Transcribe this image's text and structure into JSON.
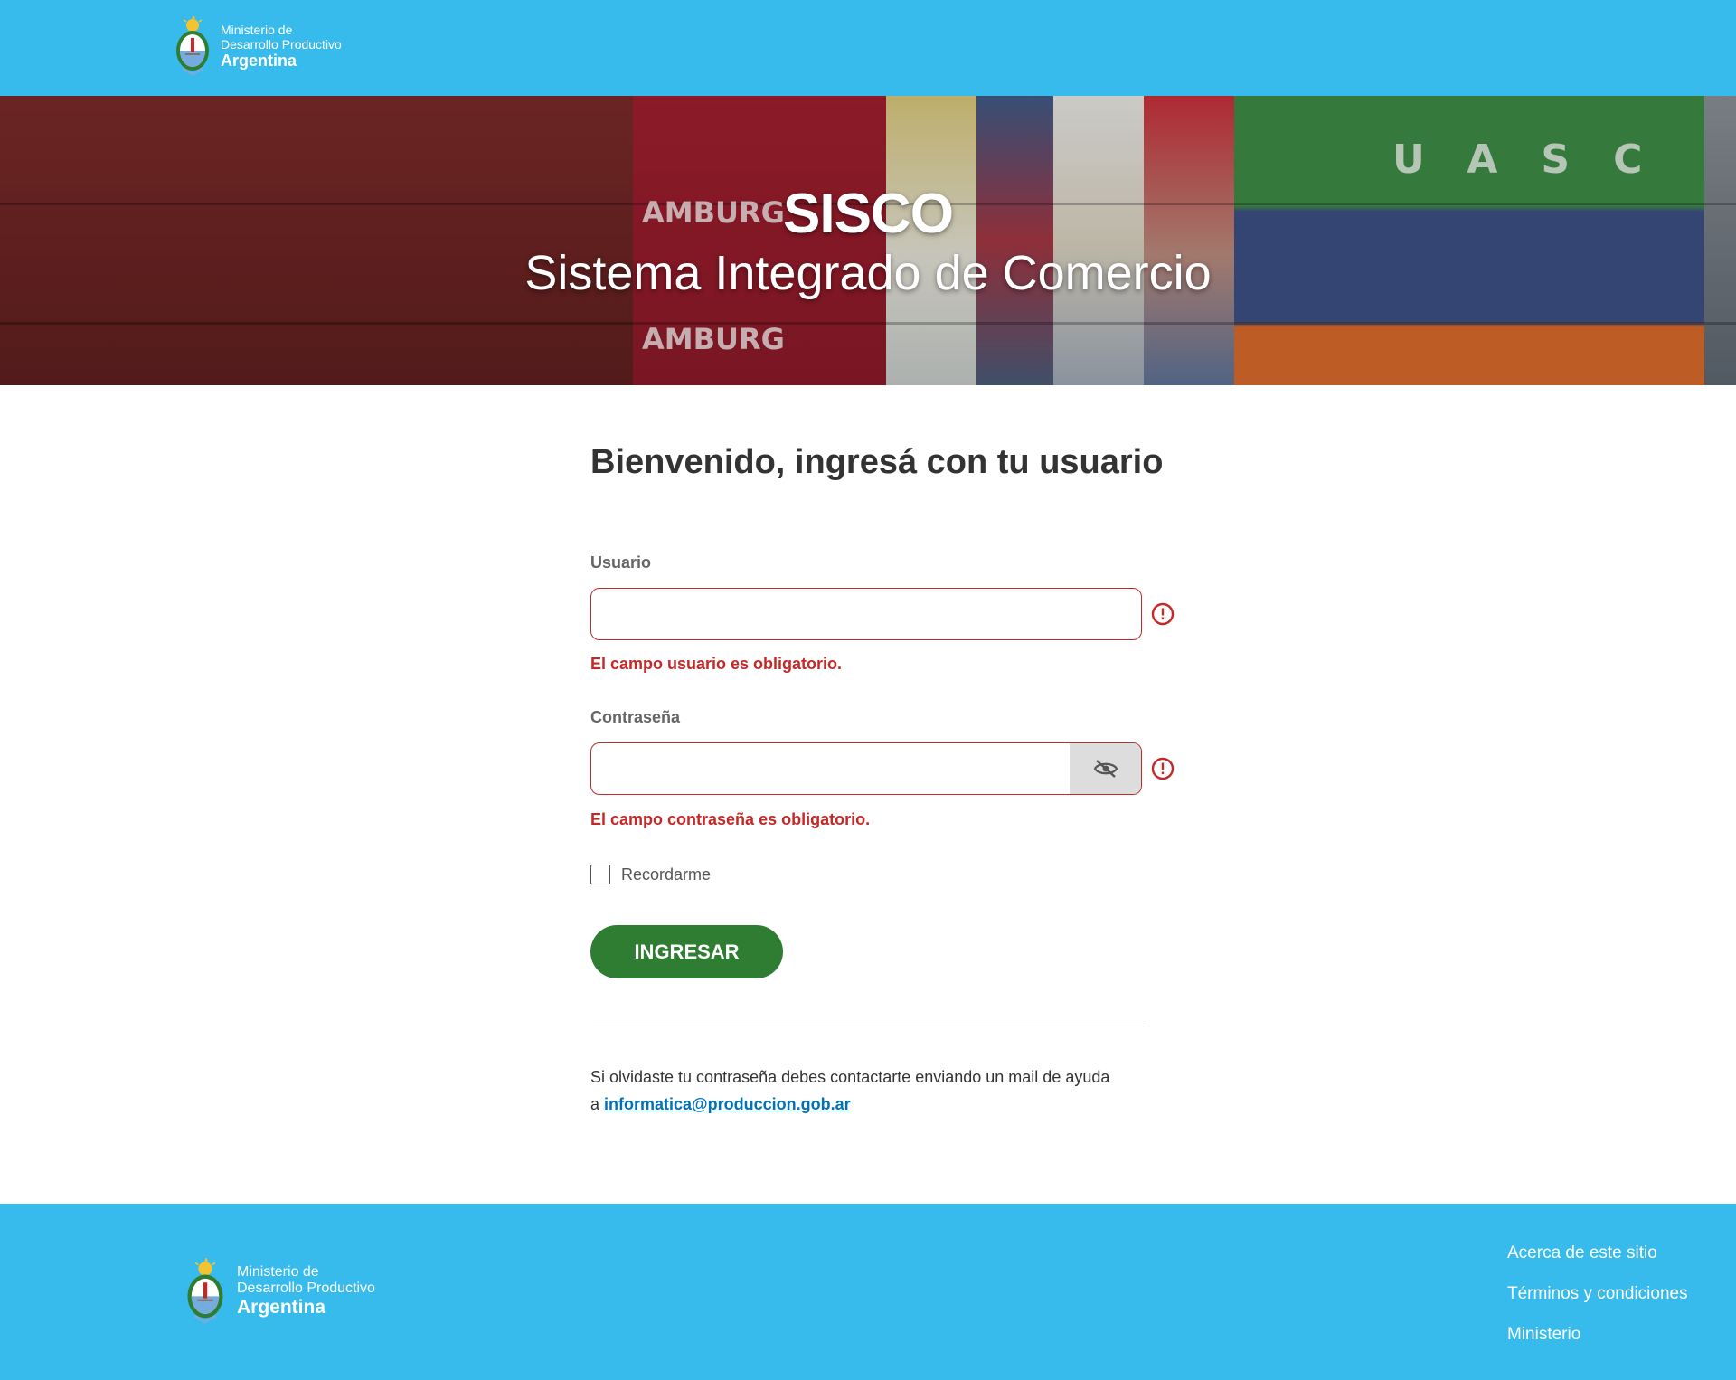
{
  "colors": {
    "brand_blue": "#37bbed",
    "error_red": "#c62828",
    "primary_green": "#2e7d32",
    "link_blue": "#0072bb"
  },
  "header": {
    "ministry_line1": "Ministerio de",
    "ministry_line2": "Desarrollo Productivo",
    "country": "Argentina"
  },
  "hero": {
    "title": "SISCO",
    "subtitle": "Sistema Integrado de Comercio"
  },
  "login": {
    "heading": "Bienvenido, ingresá con tu usuario",
    "user_label": "Usuario",
    "user_value": "",
    "user_error": "El campo usuario es obligatorio.",
    "password_label": "Contraseña",
    "password_value": "",
    "password_error": "El campo contraseña es obligatorio.",
    "remember_label": "Recordarme",
    "remember_checked": false,
    "submit_label": "INGRESAR",
    "help_text_1": "Si olvidaste tu contraseña debes contactarte enviando un mail de ayuda",
    "help_text_2": "a",
    "help_email": "informatica@produccion.gob.ar"
  },
  "footer": {
    "ministry_line1": "Ministerio de",
    "ministry_line2": "Desarrollo Productivo",
    "country": "Argentina",
    "links": [
      "Acerca de este sitio",
      "Términos y condiciones",
      "Ministerio"
    ]
  },
  "icons": {
    "seal": "argentina-coat-of-arms-icon",
    "error": "error-circle-icon",
    "eye": "eye-slash-icon"
  }
}
